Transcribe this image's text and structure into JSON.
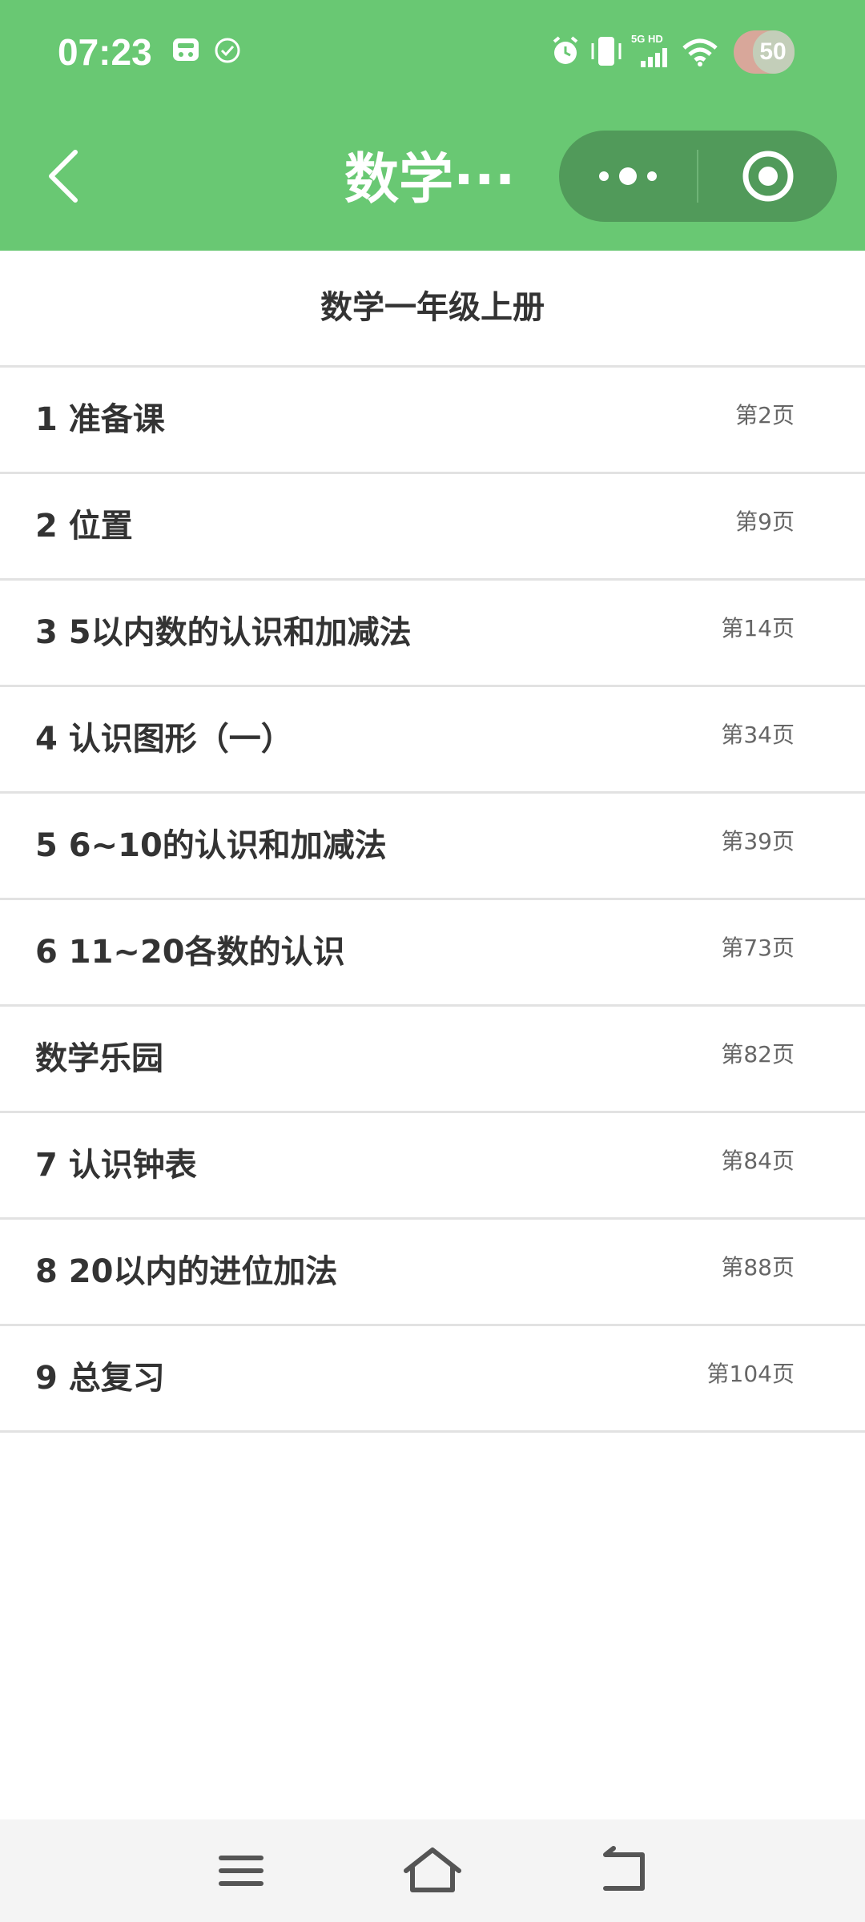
{
  "status_bar": {
    "time": "07:23",
    "network_label": "5G HD",
    "battery": "50",
    "icons": [
      "media-icon",
      "check-circle-icon",
      "alarm-icon",
      "vibrate-icon",
      "signal-icon",
      "wifi-icon",
      "battery-icon"
    ]
  },
  "title_bar": {
    "title": "数学···",
    "back_icon": "chevron-left-icon",
    "more_icon": "more-dots-icon",
    "close_icon": "target-close-icon"
  },
  "book": {
    "title": "数学一年级上册"
  },
  "chapters": [
    {
      "name": "1 准备课",
      "page": "第2页"
    },
    {
      "name": "2 位置",
      "page": "第9页"
    },
    {
      "name": "3 5以内数的认识和加减法",
      "page": "第14页"
    },
    {
      "name": "4 认识图形（一）",
      "page": "第34页"
    },
    {
      "name": "5 6~10的认识和加减法",
      "page": "第39页"
    },
    {
      "name": "6 11~20各数的认识",
      "page": "第73页"
    },
    {
      "name": "数学乐园",
      "page": "第82页"
    },
    {
      "name": "7 认识钟表",
      "page": "第84页"
    },
    {
      "name": "8 20以内的进位加法",
      "page": "第88页"
    },
    {
      "name": "9 总复习",
      "page": "第104页"
    }
  ],
  "nav_bar": {
    "icons": [
      "menu-icon",
      "home-icon",
      "back-icon"
    ]
  },
  "colors": {
    "header_green": "#69c873",
    "capsule_green": "#519a5a",
    "text_dark": "#333333",
    "text_gray": "#666666",
    "divider": "#e2e2e2"
  }
}
